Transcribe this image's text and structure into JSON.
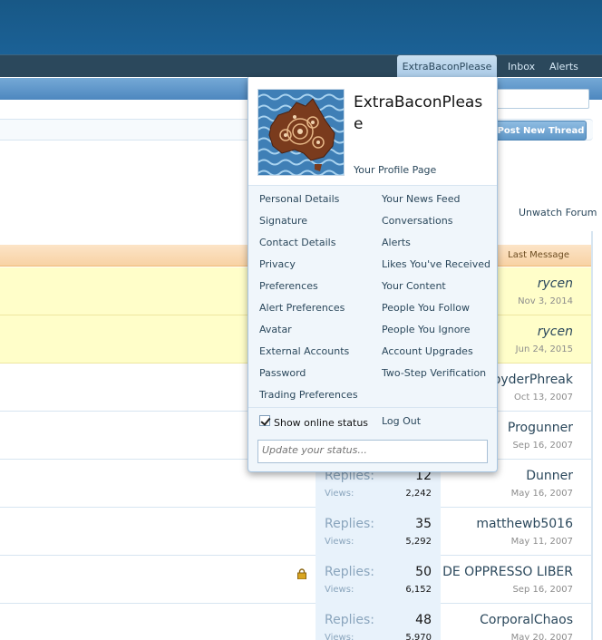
{
  "nav": {
    "user_tab": "ExtraBaconPlease",
    "inbox": "Inbox",
    "alerts": "Alerts"
  },
  "toolbar": {
    "post_new_thread": "Post New Thread",
    "unwatch_forum": "Unwatch Forum"
  },
  "list": {
    "last_message_header": "Last Message",
    "rows": [
      {
        "replies_label": "",
        "replies": "",
        "views_label": "",
        "views": "",
        "last_poster": "rycen",
        "last_date": "Nov 3, 2014",
        "sticky": true,
        "locked": false
      },
      {
        "replies_label": "",
        "replies": "",
        "views_label": "",
        "views": "",
        "last_poster": "rycen",
        "last_date": "Jun 24, 2015",
        "sticky": true,
        "locked": false
      },
      {
        "replies_label": "",
        "replies": "",
        "views_label": "",
        "views": "",
        "last_poster": "ppyderPhreak",
        "last_date": "Oct 13, 2007",
        "sticky": false,
        "locked": false
      },
      {
        "replies_label": "",
        "replies": "",
        "views_label": "",
        "views": "",
        "last_poster": "Progunner",
        "last_date": "Sep 16, 2007",
        "sticky": false,
        "locked": false
      },
      {
        "replies_label": "Replies:",
        "replies": "12",
        "views_label": "Views:",
        "views": "2,242",
        "last_poster": "Dunner",
        "last_date": "May 16, 2007",
        "sticky": false,
        "locked": false
      },
      {
        "replies_label": "Replies:",
        "replies": "35",
        "views_label": "Views:",
        "views": "5,292",
        "last_poster": "matthewb5016",
        "last_date": "May 11, 2007",
        "sticky": false,
        "locked": false
      },
      {
        "replies_label": "Replies:",
        "replies": "50",
        "views_label": "Views:",
        "views": "6,152",
        "last_poster": "DE OPPRESSO LIBER",
        "last_date": "Sep 16, 2007",
        "sticky": false,
        "locked": true
      },
      {
        "replies_label": "Replies:",
        "replies": "48",
        "views_label": "Views:",
        "views": "5,970",
        "last_poster": "CorporalChaos",
        "last_date": "May 20, 2007",
        "sticky": false,
        "locked": false
      }
    ]
  },
  "popup": {
    "username": "ExtraBaconPlease",
    "profile_link": "Your Profile Page",
    "left_menu": [
      "Personal Details",
      "Signature",
      "Contact Details",
      "Privacy",
      "Preferences",
      "Alert Preferences",
      "Avatar",
      "External Accounts",
      "Password",
      "Trading Preferences"
    ],
    "right_menu": [
      "Your News Feed",
      "Conversations",
      "Alerts",
      "Likes You've Received",
      "Your Content",
      "People You Follow",
      "People You Ignore",
      "Account Upgrades",
      "Two-Step Verification"
    ],
    "show_online_status": "Show online status",
    "show_online_checked": true,
    "log_out": "Log Out",
    "status_placeholder": "Update your status..."
  },
  "colors": {
    "header": "#185886",
    "navbar": "#2b485c",
    "link": "#2b485c",
    "sticky_row": "#fffec9",
    "list_header": "#f8d2a4"
  }
}
